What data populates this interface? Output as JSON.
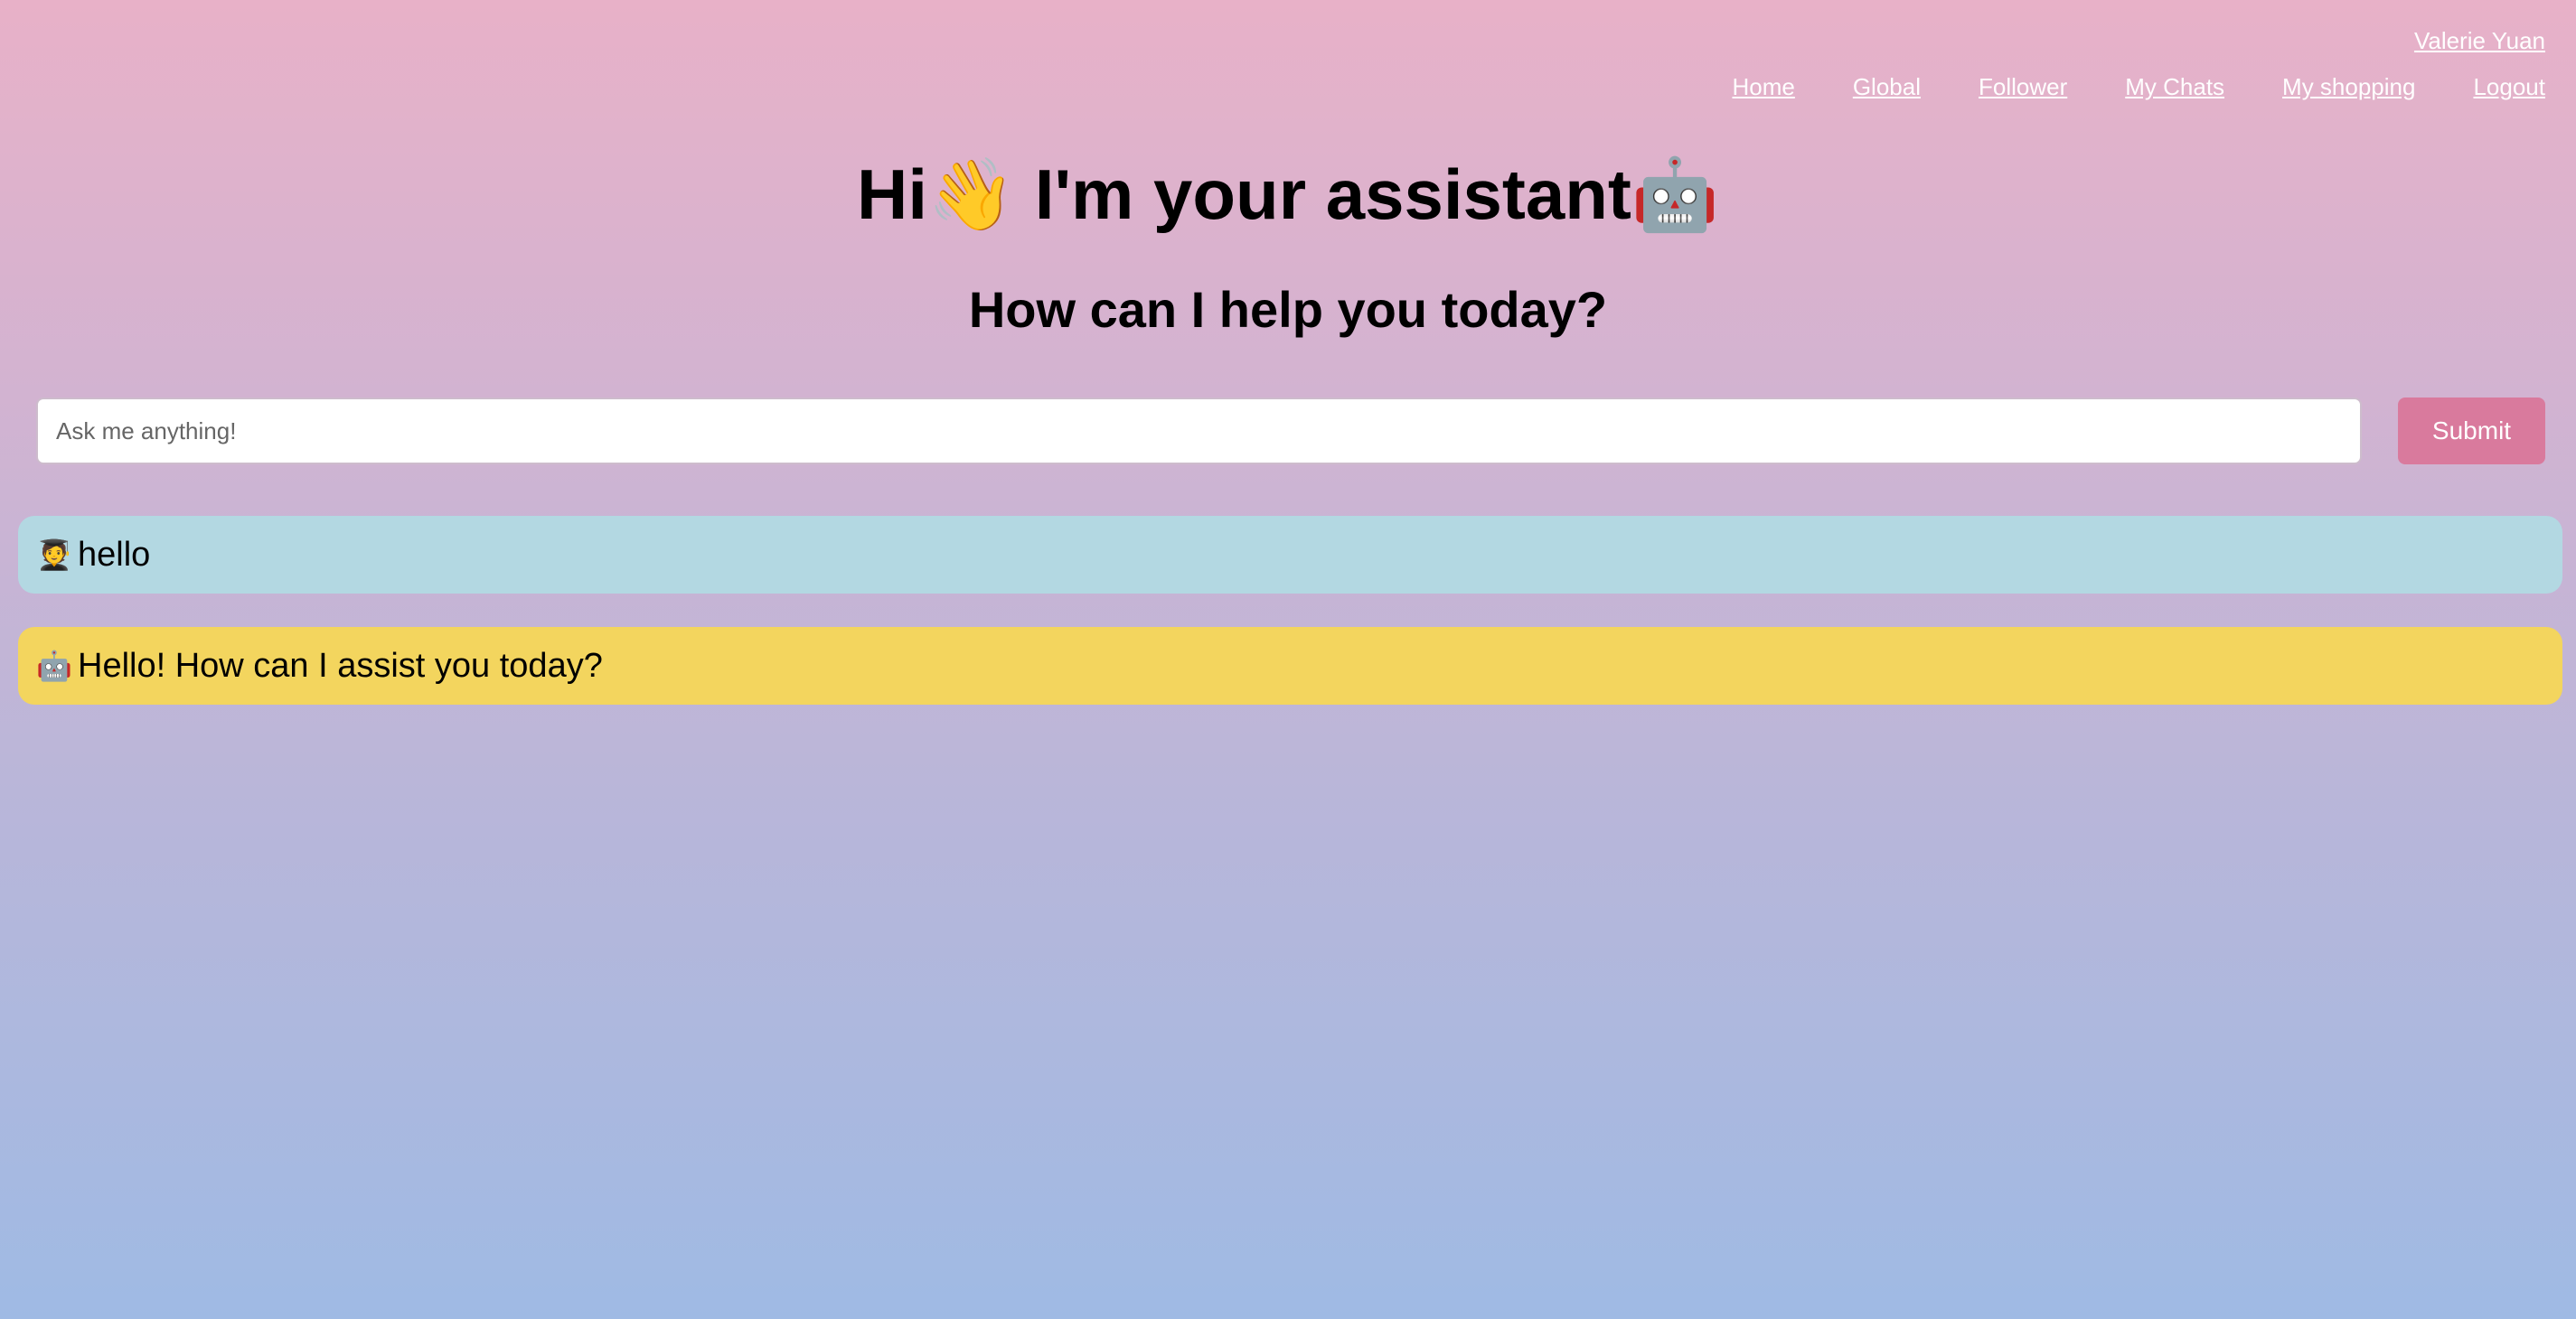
{
  "user": {
    "name": "Valerie Yuan"
  },
  "nav": {
    "items": [
      "Home",
      "Global",
      "Follower",
      "My Chats",
      "My shopping",
      "Logout"
    ]
  },
  "header": {
    "title": "Hi👋 I'm your assistant🤖",
    "subtitle": "How can I help you today?"
  },
  "input": {
    "placeholder": "Ask me anything!",
    "value": ""
  },
  "submit": {
    "label": "Submit"
  },
  "messages": [
    {
      "role": "user",
      "avatar": "🧑‍🎓",
      "text": "hello"
    },
    {
      "role": "assistant",
      "avatar": "🤖",
      "text": "Hello! How can I assist you today?"
    }
  ],
  "colors": {
    "submit_bg": "#d97a9d",
    "user_bubble": "#b3d8e2",
    "bot_bubble": "#f3d55e"
  }
}
